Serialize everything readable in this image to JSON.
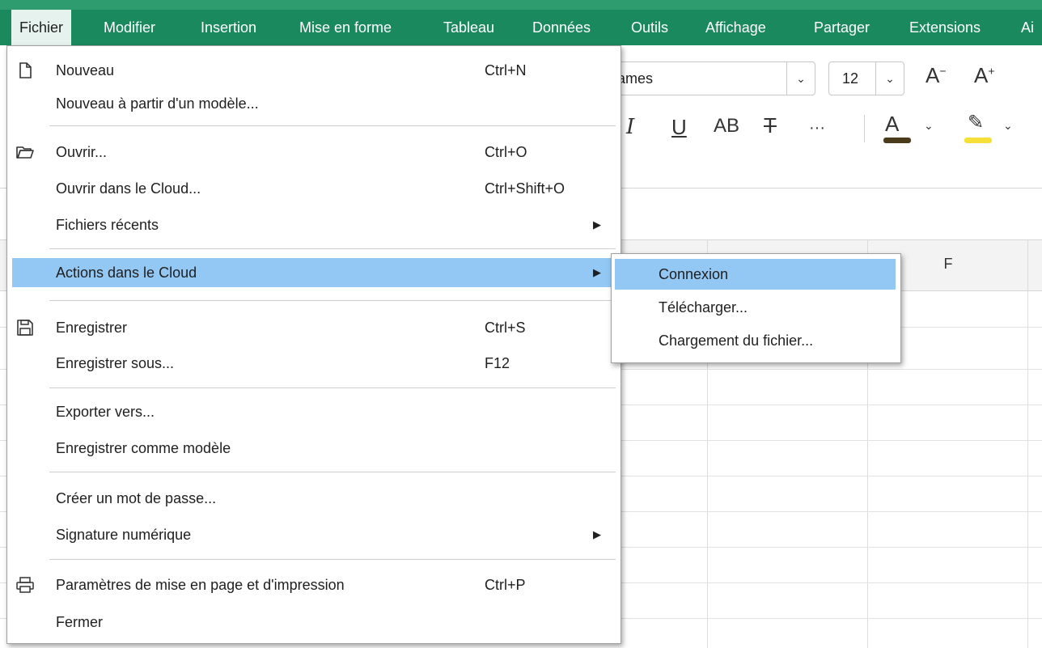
{
  "menubar": {
    "items": [
      {
        "label": "Fichier",
        "active": true
      },
      {
        "label": "Modifier"
      },
      {
        "label": "Insertion"
      },
      {
        "label": "Mise en forme"
      },
      {
        "label": "Tableau"
      },
      {
        "label": "Données"
      },
      {
        "label": "Outils"
      },
      {
        "label": "Affichage"
      },
      {
        "label": "Partager"
      },
      {
        "label": "Extensions"
      },
      {
        "label": "Ai"
      }
    ]
  },
  "toolbar": {
    "font_name": "names",
    "font_size": "12",
    "font_color": "#4a3b1a",
    "highlight_color": "#f7df3a"
  },
  "grid": {
    "columns": [
      {
        "label": "F"
      }
    ]
  },
  "file_menu": {
    "items": [
      {
        "label": "Nouveau",
        "shortcut": "Ctrl+N",
        "icon": "new-document-icon"
      },
      {
        "label": "Nouveau à partir d'un modèle..."
      },
      {
        "label": "Ouvrir...",
        "shortcut": "Ctrl+O",
        "icon": "folder-open-icon"
      },
      {
        "label": "Ouvrir dans le Cloud...",
        "shortcut": "Ctrl+Shift+O"
      },
      {
        "label": "Fichiers récents",
        "submenu": true
      },
      {
        "label": "Actions dans le Cloud",
        "submenu": true,
        "highlighted": true
      },
      {
        "label": "Enregistrer",
        "shortcut": "Ctrl+S",
        "icon": "save-icon"
      },
      {
        "label": "Enregistrer sous...",
        "shortcut": "F12"
      },
      {
        "label": "Exporter vers..."
      },
      {
        "label": "Enregistrer comme modèle"
      },
      {
        "label": "Créer un mot de passe..."
      },
      {
        "label": "Signature numérique",
        "submenu": true
      },
      {
        "label": "Paramètres de mise en page et d'impression",
        "shortcut": "Ctrl+P",
        "icon": "printer-icon"
      },
      {
        "label": "Fermer"
      }
    ]
  },
  "cloud_submenu": {
    "items": [
      {
        "label": "Connexion",
        "highlighted": true
      },
      {
        "label": "Télécharger..."
      },
      {
        "label": "Chargement du fichier..."
      }
    ]
  },
  "colors": {
    "menubar_bg": "#1a8a5e",
    "menu_highlight": "#93c7f4"
  }
}
